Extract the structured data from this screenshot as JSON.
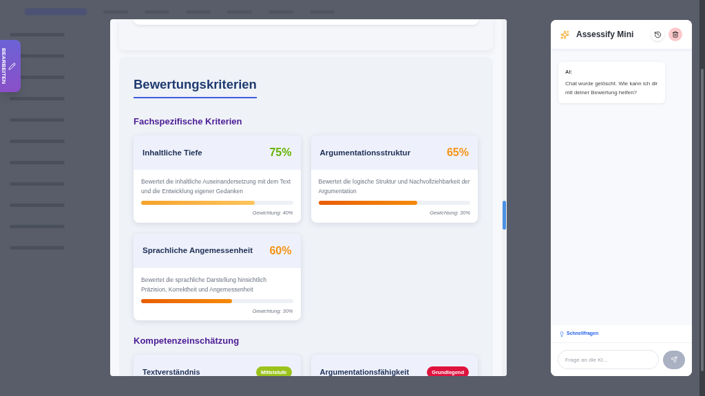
{
  "side_tab": {
    "label": "BEARBEITEN"
  },
  "modal": {
    "title": "Bewertungskriterien",
    "sections": [
      {
        "heading": "Fachspezifische Kriterien",
        "kind": "criteria",
        "items": [
          {
            "title": "Inhaltliche Tiefe",
            "percent": "75%",
            "color": "#65b300",
            "description": "Bewertet die inhaltliche Auseinandersetzung mit dem Text und die Entwicklung eigener Gedanken",
            "level": 0.75,
            "weight": "Gewichtung: 40%"
          },
          {
            "title": "Argumentationsstruktur",
            "percent": "65%",
            "color": "#f59314",
            "description": "Bewertet die logische Struktur und Nachvollziehbarkeit der Argumentation",
            "level": 0.65,
            "weight": "Gewichtung: 30%"
          },
          {
            "title": "Sprachliche Angemessenheit",
            "percent": "60%",
            "color": "#f59314",
            "description": "Bewertet die sprachliche Darstellung hinsichtlich Präzision, Korrektheit und Angemessenheit",
            "level": 0.6,
            "weight": "Gewichtung: 30%"
          }
        ]
      },
      {
        "heading": "Kompetenzeinschätzung",
        "kind": "competence",
        "items": [
          {
            "title": "Textverständnis",
            "badge": "Mittelstufe",
            "color": "#9bc31c"
          },
          {
            "title": "Argumentationsfähigkeit",
            "badge": "Grundlegend",
            "color": "#e0133f"
          }
        ]
      }
    ]
  },
  "chat": {
    "title": "Assessify Mini",
    "messages": [
      {
        "sender": "AI:",
        "text": "Chat wurde gelöscht. Wie kann ich dir mit deiner Bewertung helfen?"
      }
    ],
    "quick_questions": "Schnellfragen",
    "input": {
      "placeholder": "Frage an die KI..."
    }
  }
}
